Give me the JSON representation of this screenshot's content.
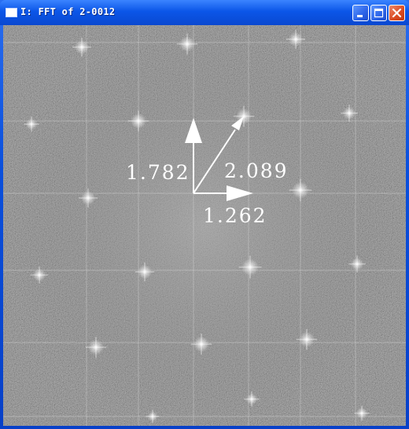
{
  "window": {
    "title": "I: FFT of 2-0012"
  },
  "controls": {
    "minimize": "minimize",
    "maximize": "maximize",
    "close": "close"
  },
  "image": {
    "annotations": {
      "vertical_label": "1.782",
      "diagonal_label": "2.089",
      "horizontal_label": "1.262"
    }
  },
  "colors": {
    "titlebar": "#0b56e8",
    "close_button": "#d9491f",
    "fft_background": "#7d7d7d",
    "annotation": "#ffffff"
  }
}
